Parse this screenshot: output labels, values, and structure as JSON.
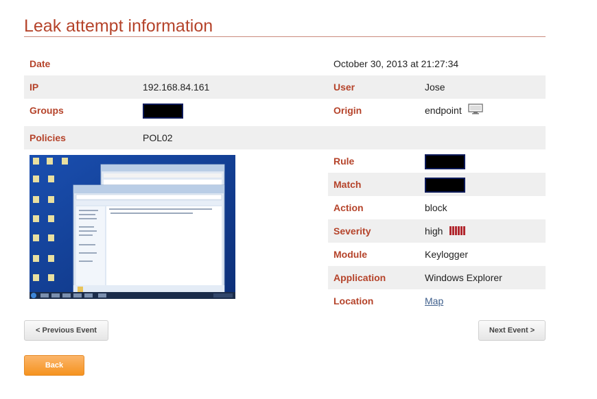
{
  "page_title": "Leak attempt information",
  "fields": {
    "date": {
      "label": "Date",
      "value": "October 30, 2013 at 21:27:34"
    },
    "ip": {
      "label": "IP",
      "value": "192.168.84.161"
    },
    "user": {
      "label": "User",
      "value": "Jose"
    },
    "groups": {
      "label": "Groups"
    },
    "origin": {
      "label": "Origin",
      "value": "endpoint"
    },
    "policies": {
      "label": "Policies",
      "value": "POL02"
    },
    "rule": {
      "label": "Rule"
    },
    "match": {
      "label": "Match"
    },
    "action": {
      "label": "Action",
      "value": "block"
    },
    "severity": {
      "label": "Severity",
      "value": "high"
    },
    "module": {
      "label": "Module",
      "value": "Keylogger"
    },
    "application": {
      "label": "Application",
      "value": "Windows Explorer"
    },
    "location": {
      "label": "Location",
      "value": "Map"
    }
  },
  "buttons": {
    "previous": "< Previous Event",
    "next": "Next Event >",
    "back": "Back"
  },
  "colors": {
    "accent": "#b5432a",
    "back_button": "#f5931f",
    "severity": "#b1272e"
  }
}
